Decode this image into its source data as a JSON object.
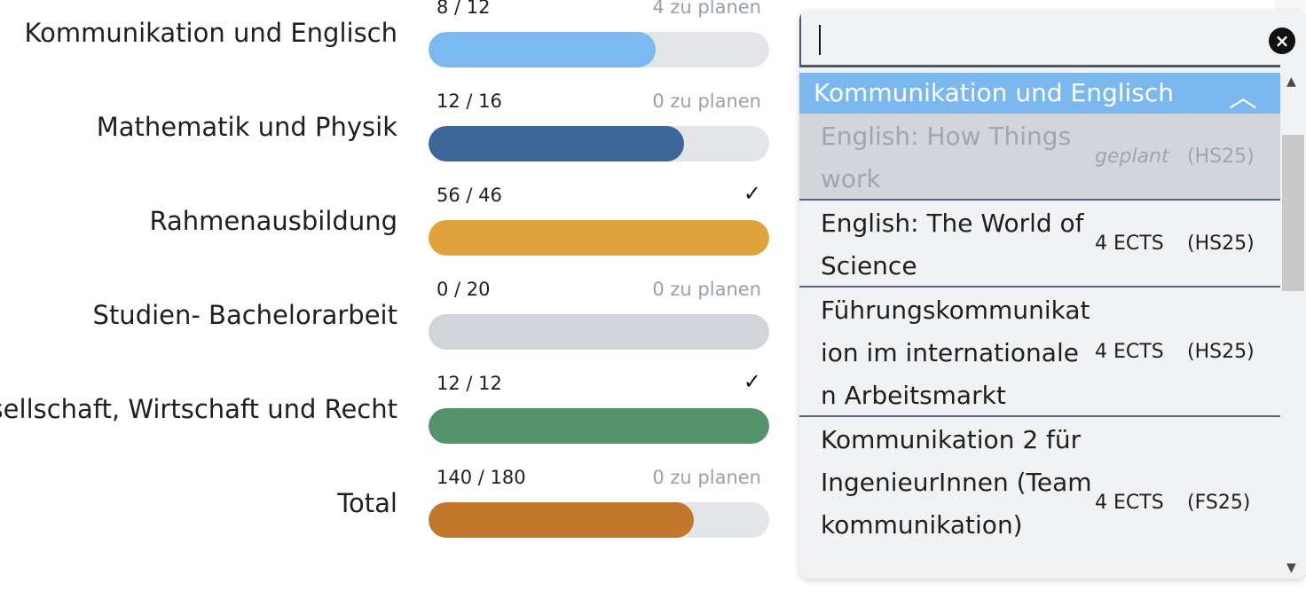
{
  "progress": [
    {
      "label": "Kommunikation und Englisch",
      "count": "8 / 12",
      "plan": "4 zu planen",
      "done": false,
      "fraction": 0.667,
      "color": "#7bb9f1"
    },
    {
      "label": "Mathematik und Physik",
      "count": "12 / 16",
      "plan": "0 zu planen",
      "done": false,
      "fraction": 0.75,
      "color": "#3d6699"
    },
    {
      "label": "Rahmenausbildung",
      "count": "56 / 46",
      "plan": "",
      "done": true,
      "fraction": 1.0,
      "color": "#e0a23a"
    },
    {
      "label": "Studien- Bachelorarbeit",
      "count": "0 / 20",
      "plan": "0 zu planen",
      "done": false,
      "fraction": 0.0,
      "color": "#d1d5d9"
    },
    {
      "label": "esellschaft, Wirtschaft und Recht",
      "count": "12 / 12",
      "plan": "",
      "done": true,
      "fraction": 1.0,
      "color": "#54926b"
    },
    {
      "label": "Total",
      "count": "140 / 180",
      "plan": "0 zu planen",
      "done": false,
      "fraction": 0.778,
      "color": "#c1782d"
    }
  ],
  "dropdown": {
    "search_value": "",
    "clear_icon": "close-circle-icon",
    "group_label": "Kommunikation und Englisch",
    "collapse_icon": "chevron-up-icon",
    "courses": [
      {
        "title": "English: How Things work",
        "ects": "geplant",
        "semester": "(HS25)",
        "planned": true
      },
      {
        "title": "English: The World of Science",
        "ects": "4 ECTS",
        "semester": "(HS25)",
        "planned": false
      },
      {
        "title": "Führungskommunikation im internationalen Arbeitsmarkt",
        "ects": "4 ECTS",
        "semester": "(HS25)",
        "planned": false
      },
      {
        "title": "Kommunikation 2 für IngenieurInnen (Teamkommunikation)",
        "ects": "4 ECTS",
        "semester": "(FS25)",
        "planned": false
      }
    ]
  }
}
